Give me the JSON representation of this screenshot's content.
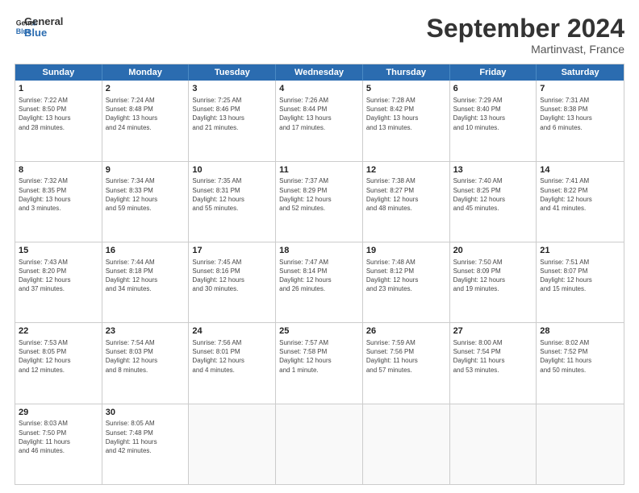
{
  "logo": {
    "line1": "General",
    "line2": "Blue"
  },
  "title": "September 2024",
  "subtitle": "Martinvast, France",
  "header_days": [
    "Sunday",
    "Monday",
    "Tuesday",
    "Wednesday",
    "Thursday",
    "Friday",
    "Saturday"
  ],
  "rows": [
    [
      {
        "day": "1",
        "text": "Sunrise: 7:22 AM\nSunset: 8:50 PM\nDaylight: 13 hours\nand 28 minutes."
      },
      {
        "day": "2",
        "text": "Sunrise: 7:24 AM\nSunset: 8:48 PM\nDaylight: 13 hours\nand 24 minutes."
      },
      {
        "day": "3",
        "text": "Sunrise: 7:25 AM\nSunset: 8:46 PM\nDaylight: 13 hours\nand 21 minutes."
      },
      {
        "day": "4",
        "text": "Sunrise: 7:26 AM\nSunset: 8:44 PM\nDaylight: 13 hours\nand 17 minutes."
      },
      {
        "day": "5",
        "text": "Sunrise: 7:28 AM\nSunset: 8:42 PM\nDaylight: 13 hours\nand 13 minutes."
      },
      {
        "day": "6",
        "text": "Sunrise: 7:29 AM\nSunset: 8:40 PM\nDaylight: 13 hours\nand 10 minutes."
      },
      {
        "day": "7",
        "text": "Sunrise: 7:31 AM\nSunset: 8:38 PM\nDaylight: 13 hours\nand 6 minutes."
      }
    ],
    [
      {
        "day": "8",
        "text": "Sunrise: 7:32 AM\nSunset: 8:35 PM\nDaylight: 13 hours\nand 3 minutes."
      },
      {
        "day": "9",
        "text": "Sunrise: 7:34 AM\nSunset: 8:33 PM\nDaylight: 12 hours\nand 59 minutes."
      },
      {
        "day": "10",
        "text": "Sunrise: 7:35 AM\nSunset: 8:31 PM\nDaylight: 12 hours\nand 55 minutes."
      },
      {
        "day": "11",
        "text": "Sunrise: 7:37 AM\nSunset: 8:29 PM\nDaylight: 12 hours\nand 52 minutes."
      },
      {
        "day": "12",
        "text": "Sunrise: 7:38 AM\nSunset: 8:27 PM\nDaylight: 12 hours\nand 48 minutes."
      },
      {
        "day": "13",
        "text": "Sunrise: 7:40 AM\nSunset: 8:25 PM\nDaylight: 12 hours\nand 45 minutes."
      },
      {
        "day": "14",
        "text": "Sunrise: 7:41 AM\nSunset: 8:22 PM\nDaylight: 12 hours\nand 41 minutes."
      }
    ],
    [
      {
        "day": "15",
        "text": "Sunrise: 7:43 AM\nSunset: 8:20 PM\nDaylight: 12 hours\nand 37 minutes."
      },
      {
        "day": "16",
        "text": "Sunrise: 7:44 AM\nSunset: 8:18 PM\nDaylight: 12 hours\nand 34 minutes."
      },
      {
        "day": "17",
        "text": "Sunrise: 7:45 AM\nSunset: 8:16 PM\nDaylight: 12 hours\nand 30 minutes."
      },
      {
        "day": "18",
        "text": "Sunrise: 7:47 AM\nSunset: 8:14 PM\nDaylight: 12 hours\nand 26 minutes."
      },
      {
        "day": "19",
        "text": "Sunrise: 7:48 AM\nSunset: 8:12 PM\nDaylight: 12 hours\nand 23 minutes."
      },
      {
        "day": "20",
        "text": "Sunrise: 7:50 AM\nSunset: 8:09 PM\nDaylight: 12 hours\nand 19 minutes."
      },
      {
        "day": "21",
        "text": "Sunrise: 7:51 AM\nSunset: 8:07 PM\nDaylight: 12 hours\nand 15 minutes."
      }
    ],
    [
      {
        "day": "22",
        "text": "Sunrise: 7:53 AM\nSunset: 8:05 PM\nDaylight: 12 hours\nand 12 minutes."
      },
      {
        "day": "23",
        "text": "Sunrise: 7:54 AM\nSunset: 8:03 PM\nDaylight: 12 hours\nand 8 minutes."
      },
      {
        "day": "24",
        "text": "Sunrise: 7:56 AM\nSunset: 8:01 PM\nDaylight: 12 hours\nand 4 minutes."
      },
      {
        "day": "25",
        "text": "Sunrise: 7:57 AM\nSunset: 7:58 PM\nDaylight: 12 hours\nand 1 minute."
      },
      {
        "day": "26",
        "text": "Sunrise: 7:59 AM\nSunset: 7:56 PM\nDaylight: 11 hours\nand 57 minutes."
      },
      {
        "day": "27",
        "text": "Sunrise: 8:00 AM\nSunset: 7:54 PM\nDaylight: 11 hours\nand 53 minutes."
      },
      {
        "day": "28",
        "text": "Sunrise: 8:02 AM\nSunset: 7:52 PM\nDaylight: 11 hours\nand 50 minutes."
      }
    ],
    [
      {
        "day": "29",
        "text": "Sunrise: 8:03 AM\nSunset: 7:50 PM\nDaylight: 11 hours\nand 46 minutes."
      },
      {
        "day": "30",
        "text": "Sunrise: 8:05 AM\nSunset: 7:48 PM\nDaylight: 11 hours\nand 42 minutes."
      },
      {
        "day": "",
        "text": ""
      },
      {
        "day": "",
        "text": ""
      },
      {
        "day": "",
        "text": ""
      },
      {
        "day": "",
        "text": ""
      },
      {
        "day": "",
        "text": ""
      }
    ]
  ]
}
